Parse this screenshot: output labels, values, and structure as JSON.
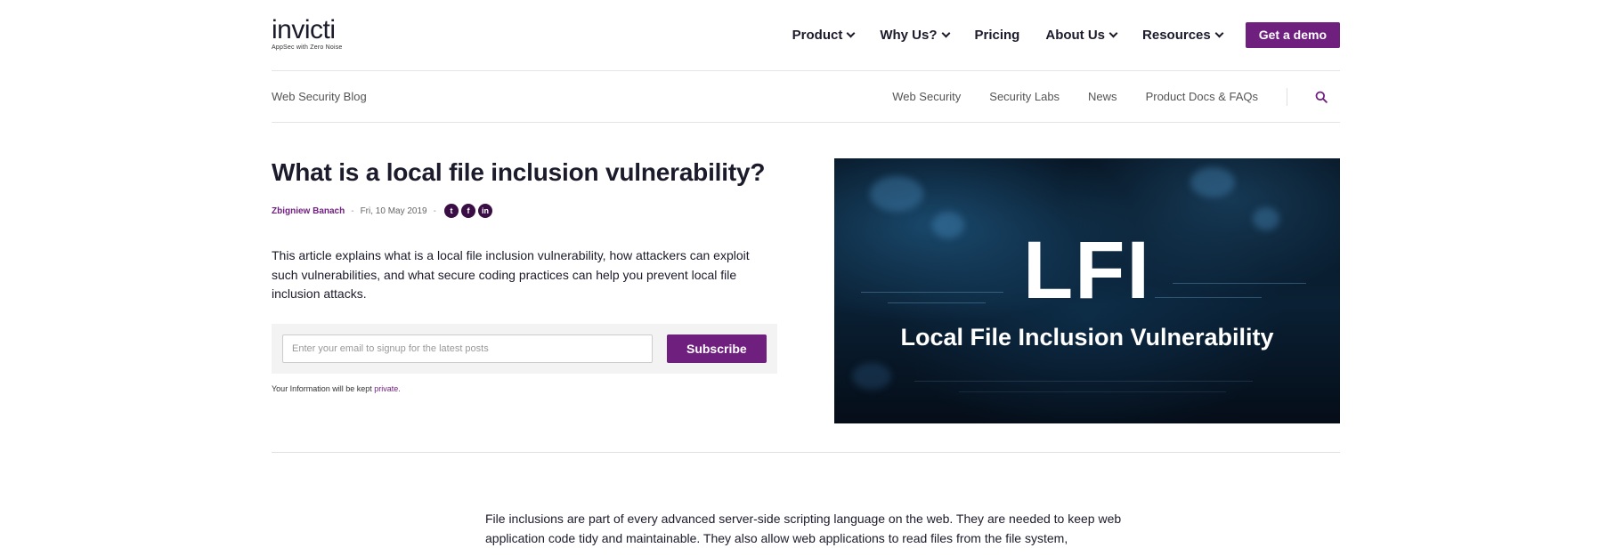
{
  "header": {
    "logo": "invicti",
    "logo_tagline": "AppSec with Zero Noise",
    "menu": [
      {
        "label": "Product",
        "dropdown": true
      },
      {
        "label": "Why Us?",
        "dropdown": true
      },
      {
        "label": "Pricing",
        "dropdown": false
      },
      {
        "label": "About Us",
        "dropdown": true
      },
      {
        "label": "Resources",
        "dropdown": true
      }
    ],
    "cta_label": "Get a demo"
  },
  "subnav": {
    "blog_title": "Web Security Blog",
    "links": [
      "Web Security",
      "Security Labs",
      "News",
      "Product Docs & FAQs"
    ],
    "search_icon": "search-icon"
  },
  "article": {
    "title": "What is a local file inclusion vulnerability?",
    "author": "Zbigniew Banach",
    "separator": "-",
    "date": "Fri, 10 May 2019",
    "social": [
      {
        "icon": "twitter-icon",
        "glyph": "t"
      },
      {
        "icon": "facebook-icon",
        "glyph": "f"
      },
      {
        "icon": "linkedin-icon",
        "glyph": "in"
      }
    ],
    "intro": "This article explains what is a local file inclusion vulnerability, how attackers can exploit such vulnerabilities, and what secure coding practices can help you prevent local file inclusion attacks.",
    "hero_image": {
      "big_text": "LFI",
      "sub_text": "Local File Inclusion Vulnerability"
    },
    "body_first_paragraph": "File inclusions are part of every advanced server-side scripting language on the web. They are needed to keep web application code tidy and maintainable. They also allow web applications to read files from the file system,"
  },
  "signup": {
    "placeholder": "Enter your email to signup for the latest posts",
    "value": "",
    "button_label": "Subscribe",
    "privacy_text": "Your Information will be kept",
    "privacy_link": "private."
  },
  "colors": {
    "brand": "#6f1f7e",
    "text": "#1b1b2b",
    "muted": "#555555"
  }
}
